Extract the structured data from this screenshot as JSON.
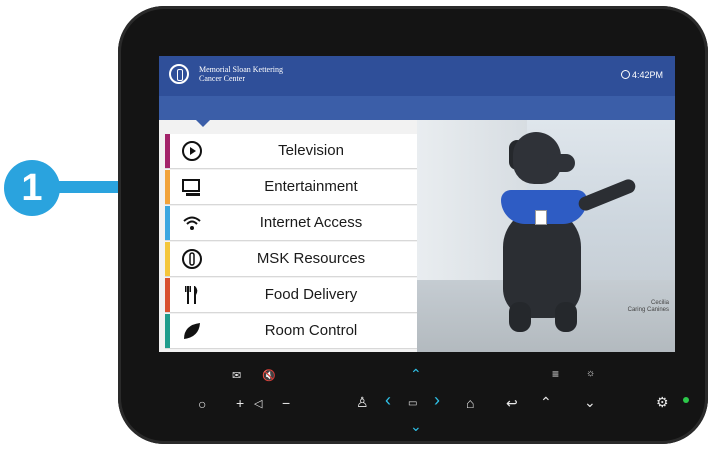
{
  "callout": {
    "number": "1"
  },
  "header": {
    "org_line1": "Memorial Sloan Kettering",
    "org_line2": "Cancer Center",
    "time": "4:42PM"
  },
  "menu": [
    {
      "label": "Television",
      "icon": "play-circle-icon",
      "accent": "#a3236a"
    },
    {
      "label": "Entertainment",
      "icon": "media-player-icon",
      "accent": "#f2a33a"
    },
    {
      "label": "Internet Access",
      "icon": "wifi-icon",
      "accent": "#3aa6e0"
    },
    {
      "label": "MSK Resources",
      "icon": "msk-logo-icon",
      "accent": "#f4c63a"
    },
    {
      "label": "Food Delivery",
      "icon": "fork-knife-icon",
      "accent": "#d8502e"
    },
    {
      "label": "Room Control",
      "icon": "leaf-icon",
      "accent": "#1f9c8c"
    }
  ],
  "photo": {
    "caption_line1": "Cecilia",
    "caption_line2": "Caring Canines"
  },
  "colors": {
    "topbar": "#2f4f99",
    "accent_blue": "#2aa3de",
    "device": "#141414"
  }
}
